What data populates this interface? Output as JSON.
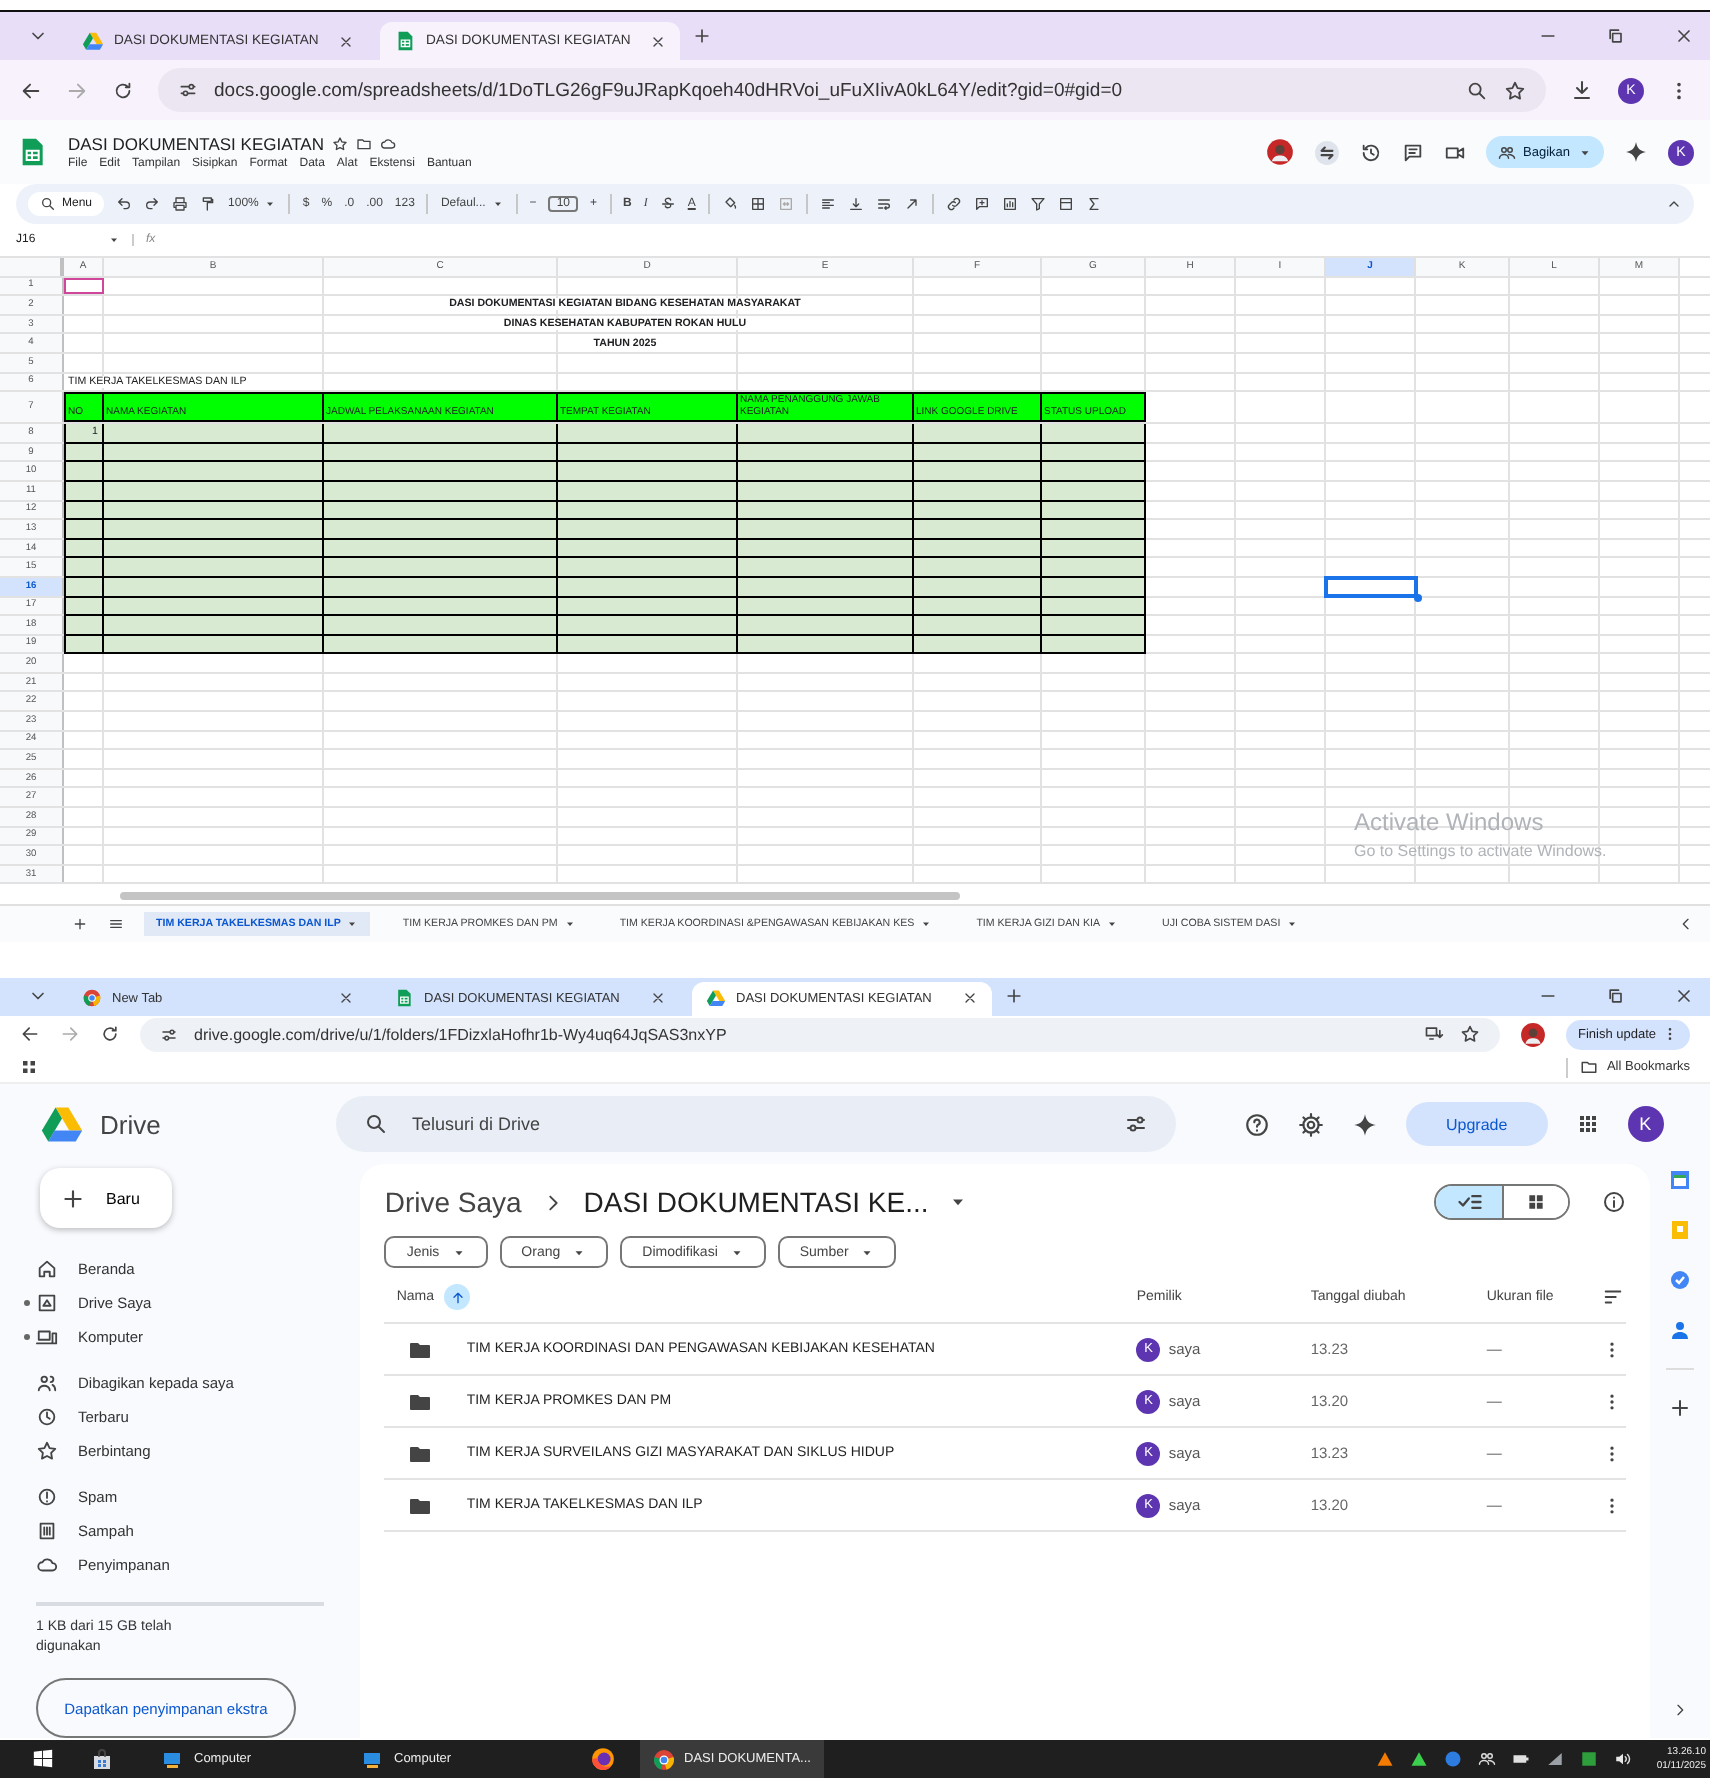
{
  "sheets_window": {
    "tabs": [
      {
        "title": "DASI DOKUMENTASI KEGIATAN",
        "kind": "drive",
        "selected": false
      },
      {
        "title": "DASI DOKUMENTASI KEGIATAN",
        "kind": "sheets",
        "selected": true
      }
    ],
    "url": "docs.google.com/spreadsheets/d/1DoTLG26gF9uJRapKqoeh40dHRVoi_uFuXIivA0kL64Y/edit?gid=0#gid=0",
    "profile_initial": "K",
    "doc_title": "DASI DOKUMENTASI KEGIATAN",
    "menu": [
      "File",
      "Edit",
      "Tampilan",
      "Sisipkan",
      "Format",
      "Data",
      "Alat",
      "Ekstensi",
      "Bantuan"
    ],
    "share_button": "Bagikan",
    "account_initial": "K",
    "toolbar": {
      "search": "Menu",
      "zoom": "100%",
      "currency": "$",
      "percent": "%",
      "decimal_less": ".0",
      "decimal_more": ".00",
      "number_format": "123",
      "font": "Defaul...",
      "minus": "−",
      "font_size": "10",
      "plus": "+",
      "bold": "B",
      "italic": "I",
      "text_color": "A"
    },
    "name_box": "J16",
    "formula_label": "fx",
    "columns": [
      {
        "label": "A",
        "selected": false
      },
      {
        "label": "B",
        "selected": false
      },
      {
        "label": "C",
        "selected": false
      },
      {
        "label": "D",
        "selected": false
      },
      {
        "label": "E",
        "selected": false
      },
      {
        "label": "F",
        "selected": false
      },
      {
        "label": "G",
        "selected": false
      },
      {
        "label": "H",
        "selected": false
      },
      {
        "label": "I",
        "selected": false
      },
      {
        "label": "J",
        "selected": true
      },
      {
        "label": "K",
        "selected": false
      },
      {
        "label": "L",
        "selected": false
      },
      {
        "label": "M",
        "selected": false
      }
    ],
    "rows": [
      {
        "label": "1",
        "kind": "blank",
        "selected": false
      },
      {
        "label": "2",
        "kind": "title",
        "text": "DASI DOKUMENTASI KEGIATAN BIDANG KESEHATAN MASYARAKAT",
        "selected": false
      },
      {
        "label": "3",
        "kind": "title",
        "text": "DINAS KESEHATAN KABUPATEN ROKAN HULU",
        "selected": false
      },
      {
        "label": "4",
        "kind": "title",
        "text": "TAHUN 2025",
        "selected": false
      },
      {
        "label": "5",
        "kind": "blank",
        "selected": false
      },
      {
        "label": "6",
        "kind": "label",
        "text": "TIM KERJA TAKELKESMAS DAN ILP",
        "selected": false
      },
      {
        "label": "7",
        "kind": "header",
        "selected": false
      },
      {
        "label": "8",
        "kind": "data",
        "no": "1",
        "selected": false
      },
      {
        "label": "9",
        "kind": "data",
        "selected": false
      },
      {
        "label": "10",
        "kind": "data",
        "selected": false
      },
      {
        "label": "11",
        "kind": "data",
        "selected": false
      },
      {
        "label": "12",
        "kind": "data",
        "selected": false
      },
      {
        "label": "13",
        "kind": "data",
        "selected": false
      },
      {
        "label": "14",
        "kind": "data",
        "selected": false
      },
      {
        "label": "15",
        "kind": "data",
        "selected": false
      },
      {
        "label": "16",
        "kind": "data",
        "selected": true
      },
      {
        "label": "17",
        "kind": "data",
        "selected": false
      },
      {
        "label": "18",
        "kind": "data",
        "selected": false
      },
      {
        "label": "19",
        "kind": "data",
        "selected": false
      },
      {
        "label": "20",
        "kind": "blank",
        "selected": false
      },
      {
        "label": "21",
        "kind": "blank",
        "selected": false
      },
      {
        "label": "22",
        "kind": "blank",
        "selected": false
      },
      {
        "label": "23",
        "kind": "blank",
        "selected": false
      },
      {
        "label": "24",
        "kind": "blank",
        "selected": false
      },
      {
        "label": "25",
        "kind": "blank",
        "selected": false
      },
      {
        "label": "26",
        "kind": "blank",
        "selected": false
      },
      {
        "label": "27",
        "kind": "blank",
        "selected": false
      },
      {
        "label": "28",
        "kind": "blank",
        "selected": false
      },
      {
        "label": "29",
        "kind": "blank",
        "selected": false
      },
      {
        "label": "30",
        "kind": "blank",
        "selected": false
      },
      {
        "label": "31",
        "kind": "blank",
        "selected": false
      }
    ],
    "table_headers": [
      "NO",
      "NAMA KEGIATAN",
      "JADWAL PELAKSANAAN KEGIATAN",
      "TEMPAT KEGIATAN",
      "NAMA PENANGGUNG JAWAB KEGIATAN",
      "LINK GOOGLE DRIVE",
      "STATUS UPLOAD"
    ],
    "sheet_tabs": [
      {
        "label": "TIM KERJA TAKELKESMAS DAN ILP",
        "selected": true
      },
      {
        "label": "TIM KERJA PROMKES DAN PM",
        "selected": false
      },
      {
        "label": "TIM KERJA KOORDINASI &PENGAWASAN KEBIJAKAN KES",
        "selected": false
      },
      {
        "label": "TIM KERJA GIZI DAN KIA",
        "selected": false
      },
      {
        "label": "UJI COBA SISTEM DASI",
        "selected": false
      }
    ],
    "activation": {
      "title": "Activate Windows",
      "subtitle": "Go to Settings to activate Windows."
    }
  },
  "drive_window": {
    "tabs": [
      {
        "title": "New Tab",
        "kind": "newtab",
        "selected": false
      },
      {
        "title": "DASI DOKUMENTASI KEGIATAN",
        "kind": "sheets",
        "selected": false
      },
      {
        "title": "DASI DOKUMENTASI KEGIATAN",
        "kind": "drive",
        "selected": true
      }
    ],
    "url": "drive.google.com/drive/u/1/folders/1FDizxlaHofhr1b-Wy4uq64JqSAS3nxYP",
    "update_button": "Finish update",
    "bookmarks": "All Bookmarks",
    "app_name": "Drive",
    "search_placeholder": "Telusuri di Drive",
    "upgrade_button": "Upgrade",
    "account_initial": "K",
    "new_button": "Baru",
    "nav_groups": [
      [
        {
          "label": "Beranda",
          "kind": "home",
          "expandable": false
        },
        {
          "label": "Drive Saya",
          "kind": "drive",
          "expandable": true
        },
        {
          "label": "Komputer",
          "kind": "computer",
          "expandable": true
        }
      ],
      [
        {
          "label": "Dibagikan kepada saya",
          "kind": "shared",
          "expandable": false
        },
        {
          "label": "Terbaru",
          "kind": "recent",
          "expandable": false
        },
        {
          "label": "Berbintang",
          "kind": "starred",
          "expandable": false
        }
      ],
      [
        {
          "label": "Spam",
          "kind": "spam",
          "expandable": false
        },
        {
          "label": "Sampah",
          "kind": "trash",
          "expandable": false
        },
        {
          "label": "Penyimpanan",
          "kind": "storage",
          "expandable": false
        }
      ]
    ],
    "storage": {
      "level": 0,
      "text": "1 KB dari 15 GB telah digunakan",
      "button": "Dapatkan penyimpanan ekstra"
    },
    "breadcrumb": [
      "Drive Saya",
      "DASI DOKUMENTASI KE..."
    ],
    "view_modes": [
      {
        "kind": "list",
        "selected": true
      },
      {
        "kind": "grid",
        "selected": false
      }
    ],
    "filters": [
      "Jenis",
      "Orang",
      "Dimodifikasi",
      "Sumber"
    ],
    "columns": [
      "Nama",
      "Pemilik",
      "Tanggal diubah",
      "Ukuran file"
    ],
    "files": [
      {
        "name": "TIM KERJA KOORDINASI DAN PENGAWASAN KEBIJAKAN KESEHATAN",
        "owner_initial": "K",
        "owner": "saya",
        "modified": "13.23",
        "size": "—"
      },
      {
        "name": "TIM KERJA PROMKES DAN PM",
        "owner_initial": "K",
        "owner": "saya",
        "modified": "13.20",
        "size": "—"
      },
      {
        "name": "TIM KERJA SURVEILANS GIZI MASYARAKAT DAN SIKLUS HIDUP",
        "owner_initial": "K",
        "owner": "saya",
        "modified": "13.23",
        "size": "—"
      },
      {
        "name": "TIM KERJA TAKELKESMAS DAN ILP",
        "owner_initial": "K",
        "owner": "saya",
        "modified": "13.20",
        "size": "—"
      }
    ]
  },
  "taskbar": {
    "items": [
      {
        "label": "Computer",
        "kind": "folder",
        "selected": false
      },
      {
        "label": "Computer",
        "kind": "folder",
        "selected": false
      },
      {
        "label": "DASI DOKUMENTA...",
        "kind": "browser",
        "selected": true
      }
    ],
    "time": "13.26.10",
    "date": "01/11/2025"
  }
}
